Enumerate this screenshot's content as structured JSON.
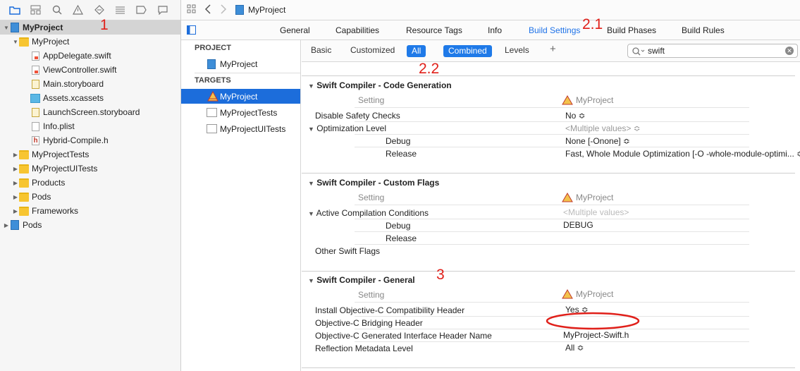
{
  "annotations": {
    "n1": "1",
    "n21": "2.1",
    "n22": "2.2",
    "n3": "3"
  },
  "navigator": {
    "icons": [
      "folder-icon",
      "source-control-icon",
      "search-icon",
      "warning-icon",
      "test-icon",
      "debug-icon",
      "breakpoint-icon",
      "report-icon"
    ],
    "rows": [
      {
        "label": "MyProject",
        "kind": "project"
      },
      {
        "label": "MyProject",
        "kind": "folder"
      },
      {
        "label": "AppDelegate.swift",
        "kind": "swift"
      },
      {
        "label": "ViewController.swift",
        "kind": "swift"
      },
      {
        "label": "Main.storyboard",
        "kind": "storyboard"
      },
      {
        "label": "Assets.xcassets",
        "kind": "assets"
      },
      {
        "label": "LaunchScreen.storyboard",
        "kind": "storyboard"
      },
      {
        "label": "Info.plist",
        "kind": "file"
      },
      {
        "label": "Hybrid-Compile.h",
        "kind": "header"
      },
      {
        "label": "MyProjectTests",
        "kind": "folder"
      },
      {
        "label": "MyProjectUITests",
        "kind": "folder"
      },
      {
        "label": "Products",
        "kind": "folder"
      },
      {
        "label": "Pods",
        "kind": "folder"
      },
      {
        "label": "Frameworks",
        "kind": "folder"
      },
      {
        "label": "Pods",
        "kind": "project"
      }
    ]
  },
  "topbar": {
    "title": "MyProject"
  },
  "tabs": [
    "General",
    "Capabilities",
    "Resource Tags",
    "Info",
    "Build Settings",
    "Build Phases",
    "Build Rules"
  ],
  "targets": {
    "project_header": "PROJECT",
    "project": "MyProject",
    "targets_header": "TARGETS",
    "items": [
      "MyProject",
      "MyProjectTests",
      "MyProjectUITests"
    ]
  },
  "filter": {
    "basic": "Basic",
    "customized": "Customized",
    "all": "All",
    "combined": "Combined",
    "levels": "Levels",
    "add": "+",
    "search_value": "swift"
  },
  "sections": {
    "codegen": {
      "title": "Swift Compiler - Code Generation",
      "col_setting": "Setting",
      "col_target": "MyProject",
      "rows": [
        {
          "label": "Disable Safety Checks",
          "value": "No ≎"
        },
        {
          "label": "Optimization Level",
          "value": "<Multiple values> ≎"
        },
        {
          "label": "Debug",
          "value": "None [-Onone] ≎"
        },
        {
          "label": "Release",
          "value": "Fast, Whole Module Optimization  [-O -whole-module-optimi...  ≎"
        }
      ]
    },
    "custom": {
      "title": "Swift Compiler - Custom Flags",
      "col_setting": "Setting",
      "col_target": "MyProject",
      "rows": [
        {
          "label": "Active Compilation Conditions",
          "value": "<Multiple values>"
        },
        {
          "label": "Debug",
          "value": "DEBUG"
        },
        {
          "label": "Release",
          "value": ""
        },
        {
          "label": "Other Swift Flags",
          "value": ""
        }
      ]
    },
    "general": {
      "title": "Swift Compiler - General",
      "col_setting": "Setting",
      "col_target": "MyProject",
      "rows": [
        {
          "label": "Install Objective-C Compatibility Header",
          "value": "Yes ≎"
        },
        {
          "label": "Objective-C Bridging Header",
          "value": ""
        },
        {
          "label": "Objective-C Generated Interface Header Name",
          "value": "MyProject-Swift.h"
        },
        {
          "label": "Reflection Metadata Level",
          "value": "All ≎"
        }
      ]
    }
  }
}
